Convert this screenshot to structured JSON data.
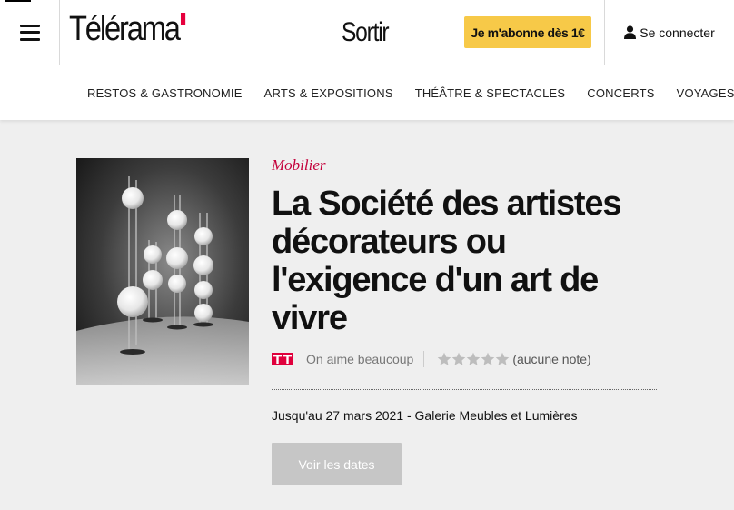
{
  "header": {
    "logo_text": "Télérama",
    "section_title": "Sortir",
    "subscribe_label": "Je m'abonne dès 1€",
    "login_label": "Se connecter"
  },
  "nav": {
    "items": [
      {
        "label": "RESTOS & GASTRONOMIE"
      },
      {
        "label": "ARTS & EXPOSITIONS"
      },
      {
        "label": "THÉÂTRE & SPECTACLES"
      },
      {
        "label": "CONCERTS"
      },
      {
        "label": "VOYAGES"
      }
    ]
  },
  "article": {
    "category": "Mobilier",
    "title": "La Société des artistes décorateurs ou l'exigence d'un art de vivre",
    "critic_logo": "TT",
    "appreciation": "On aime beaucoup",
    "stars_count": 5,
    "stars_filled": 0,
    "rating_text": "(aucune note)",
    "dates_info": "Jusqu'au 27 mars 2021 - Galerie Meubles et Lumières",
    "dates_button": "Voir les dates"
  },
  "colors": {
    "accent_red": "#e0003c",
    "category_red": "#c4003b",
    "subscribe_yellow": "#f7c948",
    "button_grey": "#c6c6c6",
    "page_bg": "#efefef"
  },
  "icons": {
    "menu": "hamburger-icon",
    "user": "user-icon",
    "star": "star-icon"
  }
}
